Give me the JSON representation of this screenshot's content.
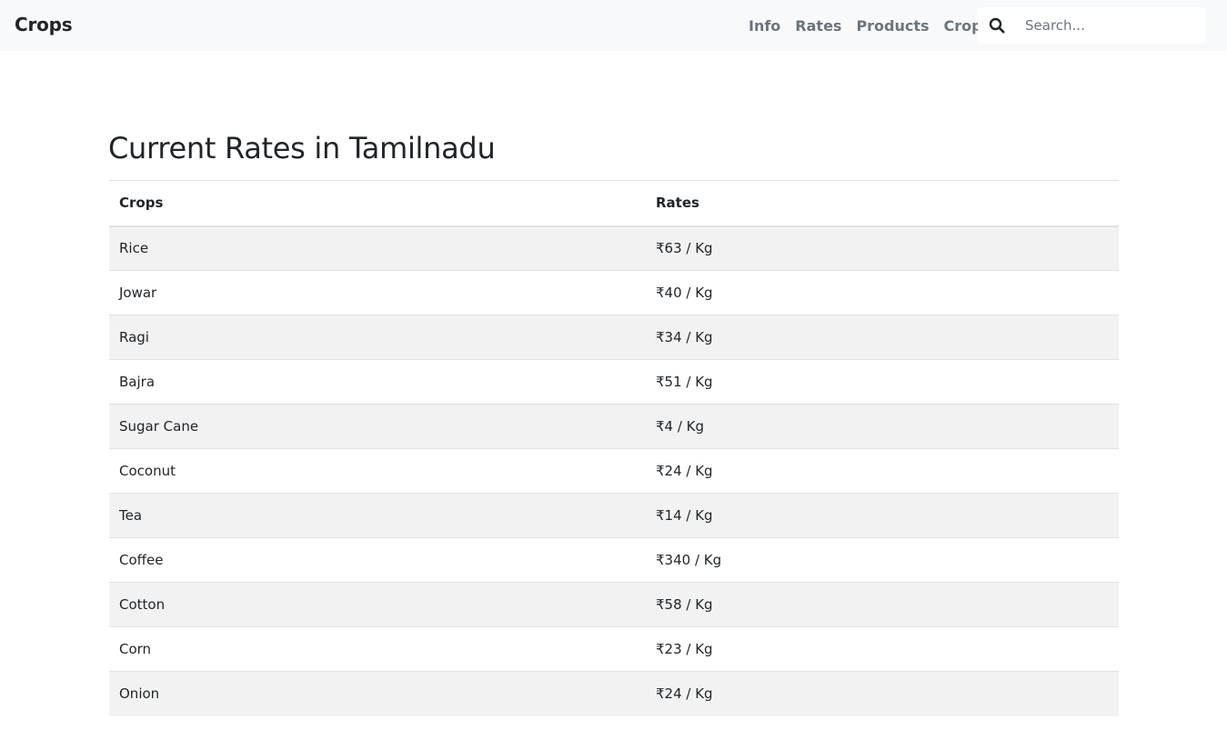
{
  "navbar": {
    "brand": "Crops",
    "links": [
      "Info",
      "Rates",
      "Products",
      "Crops"
    ],
    "search_placeholder": "Search..."
  },
  "page": {
    "title": "Current Rates in Tamilnadu"
  },
  "table": {
    "headers": [
      "Crops",
      "Rates"
    ],
    "rows": [
      {
        "crop": "Rice",
        "rate": "₹63 / Kg"
      },
      {
        "crop": "Jowar",
        "rate": "₹40 / Kg"
      },
      {
        "crop": "Ragi",
        "rate": "₹34 / Kg"
      },
      {
        "crop": "Bajra",
        "rate": "₹51 / Kg"
      },
      {
        "crop": "Sugar Cane",
        "rate": "₹4 / Kg"
      },
      {
        "crop": "Coconut",
        "rate": "₹24 / Kg"
      },
      {
        "crop": "Tea",
        "rate": "₹14 / Kg"
      },
      {
        "crop": "Coffee",
        "rate": "₹340 / Kg"
      },
      {
        "crop": "Cotton",
        "rate": "₹58 / Kg"
      },
      {
        "crop": "Corn",
        "rate": "₹23 / Kg"
      },
      {
        "crop": "Onion",
        "rate": "₹24 / Kg"
      }
    ]
  },
  "colors": {
    "navbar_bg": "#f8f9fa",
    "nav_link": "#6c757d",
    "stripe": "#f2f2f2",
    "border": "#dee2e6"
  }
}
